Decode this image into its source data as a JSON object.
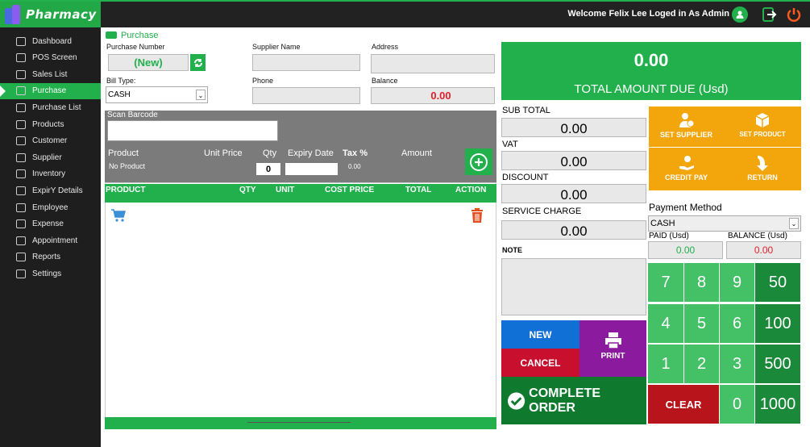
{
  "app": {
    "name": "Pharmacy",
    "welcome": "Welcome Felix Lee Loged in As Admin"
  },
  "sidebar": {
    "items": [
      {
        "label": "Dashboard"
      },
      {
        "label": "POS Screen"
      },
      {
        "label": "Sales List"
      },
      {
        "label": "Purchase"
      },
      {
        "label": "Purchase List"
      },
      {
        "label": "Products"
      },
      {
        "label": "Customer"
      },
      {
        "label": "Supplier"
      },
      {
        "label": "Inventory"
      },
      {
        "label": "ExpirY Details"
      },
      {
        "label": "Employee"
      },
      {
        "label": "Expense"
      },
      {
        "label": "Appointment"
      },
      {
        "label": "Reports"
      },
      {
        "label": "Settings"
      }
    ],
    "active": "Purchase"
  },
  "form": {
    "section_title": "Purchase",
    "purchase_number_label": "Purchase Number",
    "purchase_number_value": "(New)",
    "supplier_name_label": "Supplier Name",
    "address_label": "Address",
    "bill_type_label": "Bill Type:",
    "bill_type_value": "CASH",
    "phone_label": "Phone",
    "balance_label": "Balance",
    "balance_value": "0.00"
  },
  "scan": {
    "barcode_label": "Scan Barcode",
    "product_label": "Product",
    "product_value": "No Product",
    "unit_price_label": "Unit Price",
    "qty_label": "Qty",
    "qty_value": "0",
    "expiry_label": "Expiry Date",
    "tax_label": "Tax %",
    "tax_value": "0.00",
    "amount_label": "Amount"
  },
  "table": {
    "headers": [
      "PRODUCT",
      "QTY",
      "UNIT",
      "COST PRICE",
      "TOTAL",
      "ACTION"
    ]
  },
  "totals": {
    "amount_due": "0.00",
    "amount_due_label": "TOTAL AMOUNT DUE (Usd)",
    "subtotal_label": "SUB TOTAL",
    "subtotal": "0.00",
    "vat_label": "VAT",
    "vat": "0.00",
    "discount_label": "DISCOUNT",
    "discount": "0.00",
    "service_label": "SERVICE CHARGE",
    "service": "0.00",
    "note_label": "NOTE"
  },
  "actions": {
    "set_supplier": "SET SUPPLIER",
    "set_product": "SET PRODUCT",
    "credit_pay": "CREDIT PAY",
    "return": "RETURN",
    "new": "NEW",
    "cancel": "CANCEL",
    "print": "PRINT",
    "complete": "COMPLETE ORDER"
  },
  "payment": {
    "method_label": "Payment Method",
    "method_value": "CASH",
    "paid_label": "PAID (Usd)",
    "paid_value": "0.00",
    "balance_label": "BALANCE (Usd)",
    "balance_value": "0.00"
  },
  "keypad": {
    "keys": [
      "7",
      "8",
      "9",
      "50",
      "4",
      "5",
      "6",
      "100",
      "1",
      "2",
      "3",
      "500",
      "CLEAR",
      "0",
      "1000"
    ]
  },
  "colors": {
    "green": "#21b04b",
    "dark_green": "#0f7a2e",
    "orange": "#f2a60c",
    "red": "#c8102e",
    "blue": "#1170d6",
    "purple": "#8b1a9e"
  }
}
